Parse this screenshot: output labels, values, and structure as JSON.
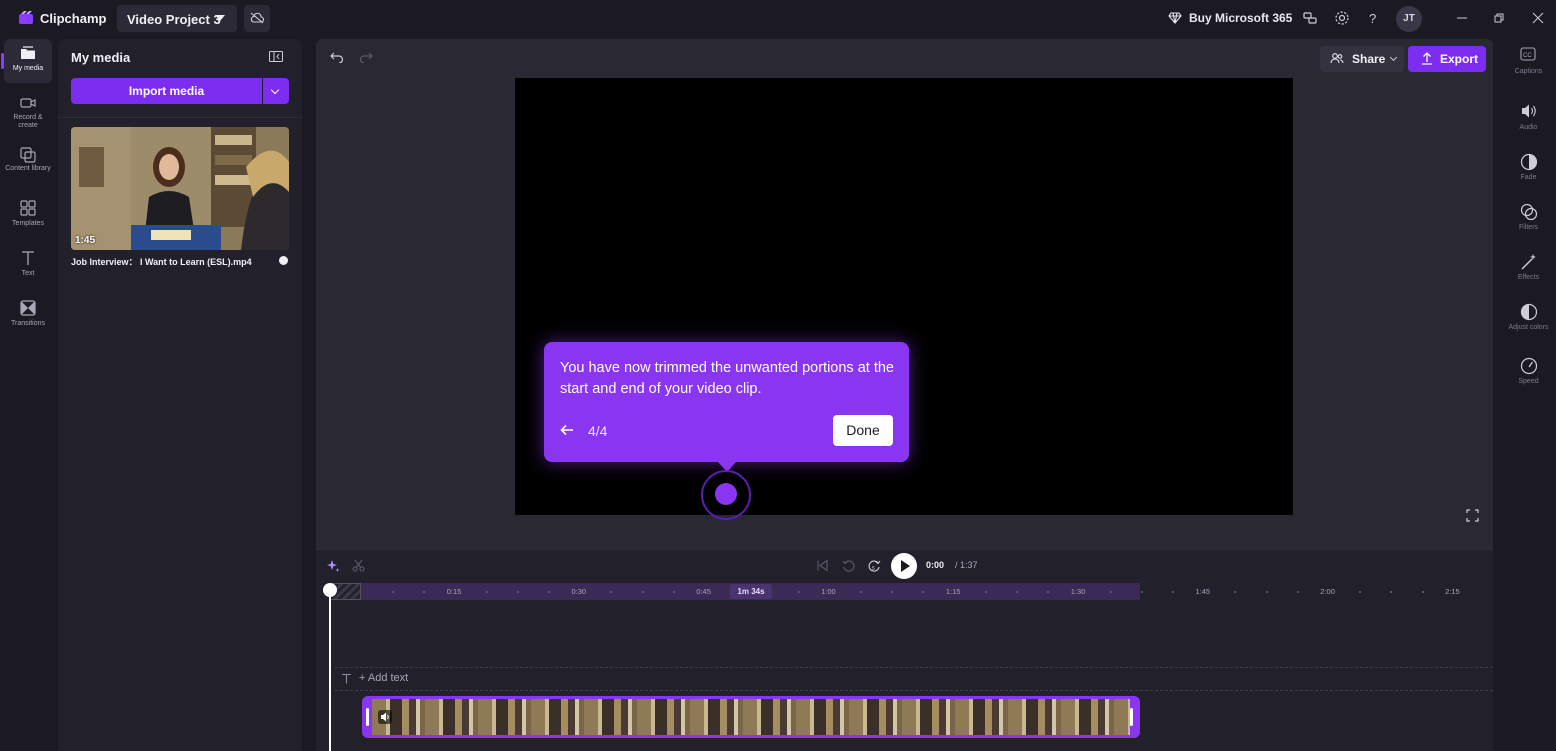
{
  "titlebar": {
    "app_name": "Clipchamp",
    "project_name": "Video Project 3",
    "buy_label": "Buy Microsoft 365",
    "avatar_initials": "JT"
  },
  "leftnav": {
    "items": [
      {
        "label": "My media",
        "icon": "folder-icon",
        "active": true
      },
      {
        "label": "Record & create",
        "icon": "camera-icon"
      },
      {
        "label": "Content library",
        "icon": "library-icon"
      },
      {
        "label": "Templates",
        "icon": "templates-icon"
      },
      {
        "label": "Text",
        "icon": "text-icon"
      },
      {
        "label": "Transitions",
        "icon": "transitions-icon"
      }
    ]
  },
  "media": {
    "title": "My media",
    "import_label": "Import media",
    "clip": {
      "duration": "1:45",
      "name": "Job Interview：  I Want to Learn (ESL).mp4"
    }
  },
  "toolbar": {
    "share_label": "Share",
    "export_label": "Export"
  },
  "tour": {
    "text": "You have now trimmed the unwanted portions at the start and end of your video clip.",
    "step": "4/4",
    "done_label": "Done"
  },
  "timeline": {
    "current_time": "0:00",
    "total_time": "/ 1:37",
    "trim_badge": "1m 34s",
    "ticks": [
      "0:15",
      "0:30",
      "0:45",
      "1:00",
      "1:15",
      "1:30",
      "1:45",
      "2:00",
      "2:15"
    ],
    "add_text_label": "+ Add text"
  },
  "rightnav": {
    "items": [
      {
        "label": "Captions",
        "icon": "captions-icon"
      },
      {
        "label": "Audio",
        "icon": "speaker-icon"
      },
      {
        "label": "Fade",
        "icon": "fade-icon"
      },
      {
        "label": "Filters",
        "icon": "filters-icon"
      },
      {
        "label": "Effects",
        "icon": "magic-wand-icon"
      },
      {
        "label": "Adjust colors",
        "icon": "contrast-icon"
      },
      {
        "label": "Speed",
        "icon": "speedometer-icon"
      }
    ]
  },
  "colors": {
    "accent": "#7c2df0",
    "tour_bg": "#8a36f0",
    "app_bg": "#1b1a22"
  }
}
